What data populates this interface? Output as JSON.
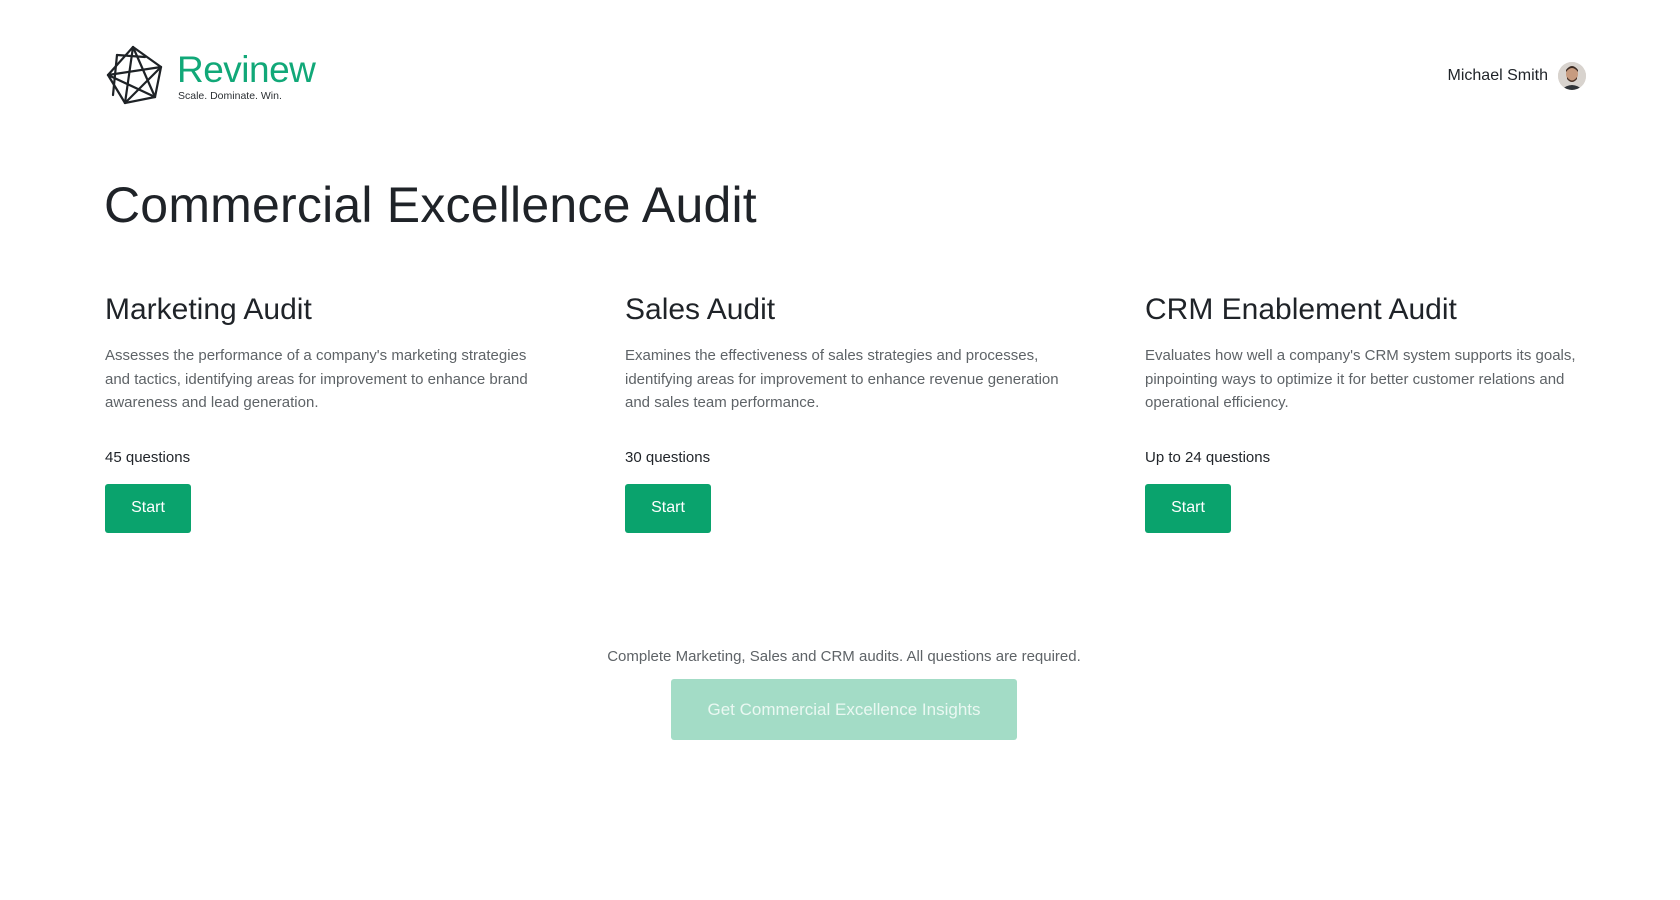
{
  "brand": {
    "name": "Revinew",
    "tagline": "Scale. Dominate. Win.",
    "logo_icon": "network-star-logo",
    "accent_color": "#11a878"
  },
  "user": {
    "name": "Michael Smith",
    "avatar_icon": "user-avatar"
  },
  "page": {
    "title": "Commercial Excellence Audit"
  },
  "audits": [
    {
      "title": "Marketing Audit",
      "description": "Assesses the performance of a company's marketing strategies and tactics, identifying areas for improvement to enhance brand awareness and lead generation.",
      "questions": "45 questions",
      "start_label": "Start"
    },
    {
      "title": "Sales Audit",
      "description": "Examines the effectiveness of sales strategies and processes, identifying areas for improvement to enhance revenue generation and sales team performance.",
      "questions": "30 questions",
      "start_label": "Start"
    },
    {
      "title": "CRM Enablement Audit",
      "description": "Evaluates how well a company's CRM system supports its goals, pinpointing ways to optimize it for better customer relations and operational efficiency.",
      "questions": "Up to 24 questions",
      "start_label": "Start"
    }
  ],
  "footer": {
    "note": "Complete Marketing, Sales and CRM audits. All questions are required.",
    "cta_label": "Get Commercial Excellence Insights",
    "cta_disabled": true
  },
  "colors": {
    "primary_button": "#0aa36d",
    "disabled_button": "#a3dcc6",
    "text_primary": "#1f2328",
    "text_secondary": "#5e6367"
  }
}
